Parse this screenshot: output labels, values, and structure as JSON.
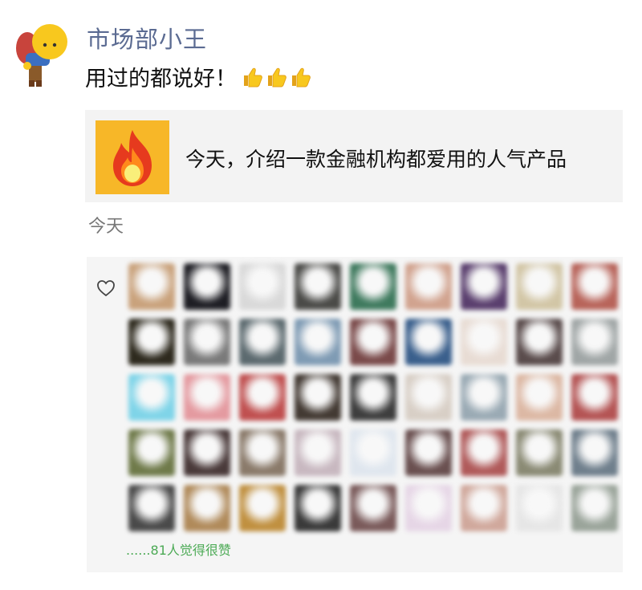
{
  "post": {
    "author": "市场部小王",
    "text": "用过的都说好！",
    "emoji": [
      "thumbs-up-icon",
      "thumbs-up-icon",
      "thumbs-up-icon"
    ],
    "share_card": {
      "icon": "fire-icon",
      "title": "今天，介绍一款金融机构都爱用的人气产品"
    },
    "timestamp": "今天"
  },
  "likes": {
    "icon": "heart-icon",
    "summary": "......81人觉得很赞",
    "avatar_colors": [
      "#c9a27c",
      "#1e1e24",
      "#d9d9d9",
      "#4b4b48",
      "#3f7a5e",
      "#d1a38f",
      "#5a3f6e",
      "#d2c6a6",
      "#b8645a",
      "#2e2a1e",
      "#7a7a7a",
      "#5c6a6f",
      "#7f9bb4",
      "#7a4a4a",
      "#3a5f8c",
      "#e8dcd4",
      "#5a4c4c",
      "#a0a6a6",
      "#7fd4e8",
      "#e49aa0",
      "#c05050",
      "#433a33",
      "#3e3e3e",
      "#d8cfc6",
      "#9aaab4",
      "#dcb8a4",
      "#b45454",
      "#6f7a4a",
      "#4a3a3a",
      "#8a7a6a",
      "#c8b8c0",
      "#dfe6ee",
      "#6a5050",
      "#b05a5a",
      "#8a8a74",
      "#6f7f8c",
      "#4a4a4a",
      "#b08a5a",
      "#c09040",
      "#3a3a3a",
      "#7a5a5a",
      "#e6d6e6",
      "#d0a89c",
      "#e6e6e6",
      "#9aa49a"
    ]
  }
}
